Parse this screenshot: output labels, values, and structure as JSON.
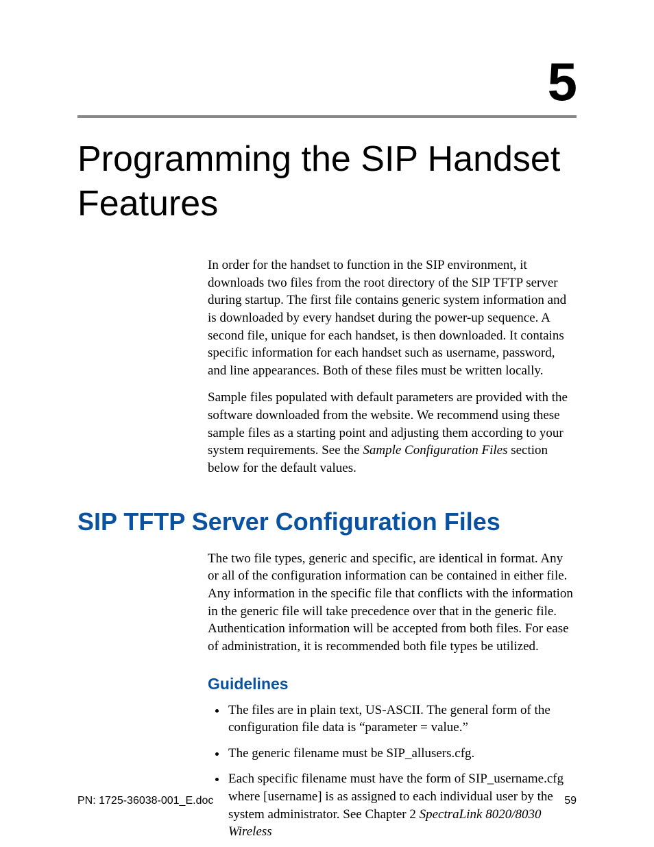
{
  "chapter": {
    "number": "5",
    "title": "Programming the SIP Handset Features"
  },
  "intro": {
    "p1": "In order for the handset to function in the SIP environment, it downloads two files from the root directory of the SIP TFTP server during startup. The first file contains generic system information and is downloaded by every handset during the power-up sequence. A second file, unique for each handset, is then downloaded. It contains specific information for each handset such as username, password, and line appearances. Both of these files must be written locally.",
    "p2_pre": "Sample files populated with default parameters are provided with the software downloaded from the website. We recommend using these sample files as a starting point and adjusting them according to your system requirements. See the ",
    "p2_em": "Sample Configuration Files",
    "p2_post": " section below for the default values."
  },
  "section": {
    "title": "SIP TFTP Server Configuration Files",
    "p1": "The two file types, generic and specific, are identical in format. Any or all of the configuration information can be contained in either file. Any information in the specific file that conflicts with the information in the generic file will take precedence over that in the generic file. Authentication information will be accepted from both files. For ease of administration, it is recommended both file types be utilized."
  },
  "guidelines": {
    "title": "Guidelines",
    "items": {
      "i0": "The files are in plain text, US-ASCII. The general form of the configuration file data is “parameter = value.”",
      "i1": "The generic filename must be SIP_allusers.cfg.",
      "i2_pre": "Each specific filename must have the form of SIP_username.cfg where [username] is as assigned to each individual user by the system administrator. See Chapter 2 ",
      "i2_em": "SpectraLink 8020/8030 Wireless"
    }
  },
  "footer": {
    "left": "PN: 1725-36038-001_E.doc",
    "right": "59"
  }
}
